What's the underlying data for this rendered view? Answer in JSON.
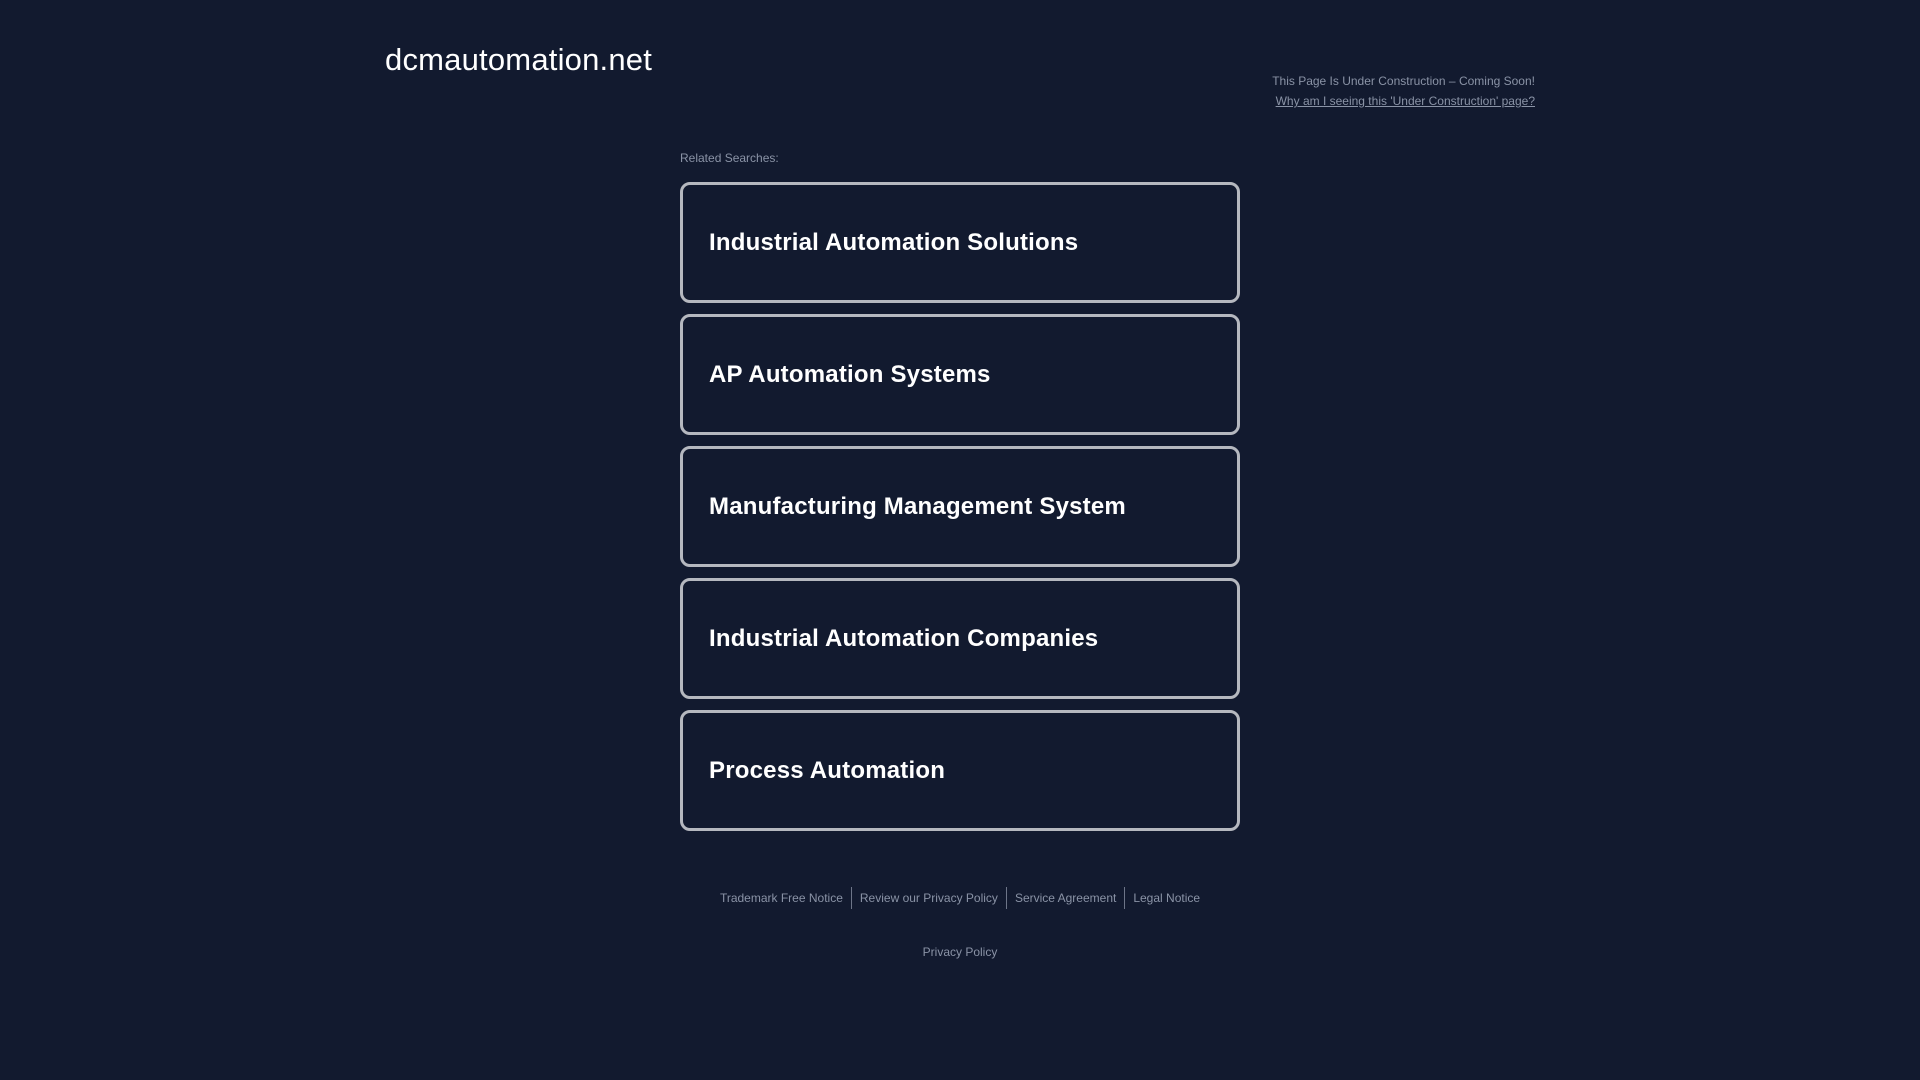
{
  "header": {
    "domain": "dcmautomation.net",
    "notice": "This Page Is Under Construction – Coming Soon!",
    "why_link": "Why am I seeing this 'Under Construction' page?"
  },
  "related": {
    "label": "Related Searches:",
    "items": [
      {
        "label": "Industrial Automation Solutions"
      },
      {
        "label": "AP Automation Systems"
      },
      {
        "label": "Manufacturing Management System"
      },
      {
        "label": "Industrial Automation Companies"
      },
      {
        "label": "Process Automation"
      }
    ]
  },
  "footer": {
    "links": [
      {
        "label": "Trademark Free Notice"
      },
      {
        "label": "Review our Privacy Policy"
      },
      {
        "label": "Service Agreement"
      },
      {
        "label": "Legal Notice"
      }
    ],
    "privacy": "Privacy Policy"
  },
  "colors": {
    "background": "#121a2f",
    "card_border": "#b5b8bf",
    "muted_text": "#8a93a6",
    "title_text": "#ffffff"
  }
}
